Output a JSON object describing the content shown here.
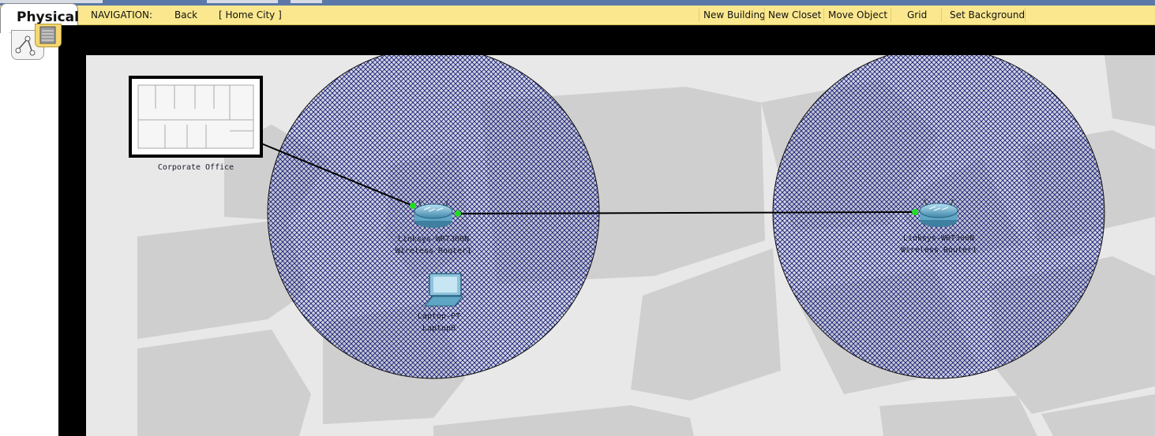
{
  "tab": {
    "label": "Physical"
  },
  "toolbar": {
    "navigation_label": "NAVIGATION:",
    "back_label": "Back",
    "location": "[ Home City ]",
    "new_building": "New Building",
    "new_closet": "New Closet",
    "move_object": "Move Object",
    "grid": "Grid",
    "set_background": "Set Background"
  },
  "map": {
    "building": {
      "label": "Corporate Office"
    },
    "devices": [
      {
        "name": "router-1",
        "line1": "Linksys-WRT300N",
        "line2": "Wireless Router1"
      },
      {
        "name": "laptop",
        "line1": "Laptop-PT",
        "line2": "Laptop0"
      },
      {
        "name": "router-2",
        "line1": "Linksys-WRT300N",
        "line2": "Wireless Router1"
      }
    ]
  },
  "colors": {
    "toolbar_bg": "#fbe88e",
    "coverage_hatch": "#1a1f7a",
    "link_light": "#22dd22",
    "map_background": "#e8e8e8",
    "map_blocks": "#cfcfcf"
  },
  "icons": [
    "physical-sub-icon",
    "cluster-icon",
    "router-icon",
    "laptop-icon",
    "building-icon"
  ]
}
